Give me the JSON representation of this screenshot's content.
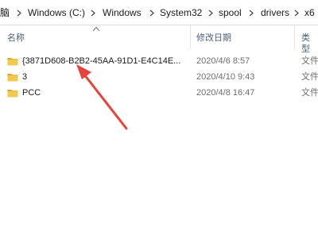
{
  "breadcrumb": {
    "items": [
      {
        "label": "脑"
      },
      {
        "label": "Windows (C:)"
      },
      {
        "label": "Windows"
      },
      {
        "label": "System32"
      },
      {
        "label": "spool"
      },
      {
        "label": "drivers"
      },
      {
        "label": "x6"
      }
    ]
  },
  "columns": {
    "name": "名称",
    "date": "修改日期",
    "type": "类型"
  },
  "files": [
    {
      "name": "{3871D608-B2B2-45AA-91D1-E4C14E...",
      "date": "2020/4/6 8:57",
      "type": "文件"
    },
    {
      "name": "3",
      "date": "2020/4/10 9:43",
      "type": "文件"
    },
    {
      "name": "PCC",
      "date": "2020/4/8 16:47",
      "type": "文件"
    }
  ],
  "colors": {
    "folder": "#f2c94c",
    "folder_dark": "#dcaa2a",
    "annotation_arrow": "#e8423a"
  },
  "icons": [
    "chevron-right-icon",
    "sort-up-icon",
    "folder-icon"
  ]
}
